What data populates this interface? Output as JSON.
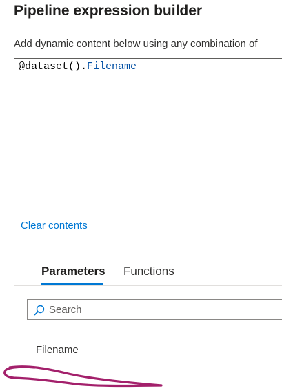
{
  "dialog": {
    "title": "Pipeline expression builder",
    "subtitle": "Add dynamic content below using any combination of"
  },
  "editor": {
    "expression_func": "@dataset().",
    "expression_prop": "Filename"
  },
  "actions": {
    "clear_label": "Clear contents"
  },
  "tabs": [
    {
      "label": "Parameters",
      "active": true
    },
    {
      "label": "Functions",
      "active": false
    }
  ],
  "search": {
    "placeholder": "Search",
    "value": ""
  },
  "parameters": [
    {
      "name": "Filename"
    }
  ],
  "colors": {
    "accent": "#0078d4",
    "expression_property": "#0451a5",
    "annotation_mark": "#a3206b"
  },
  "icons": {
    "search": "search-icon"
  }
}
